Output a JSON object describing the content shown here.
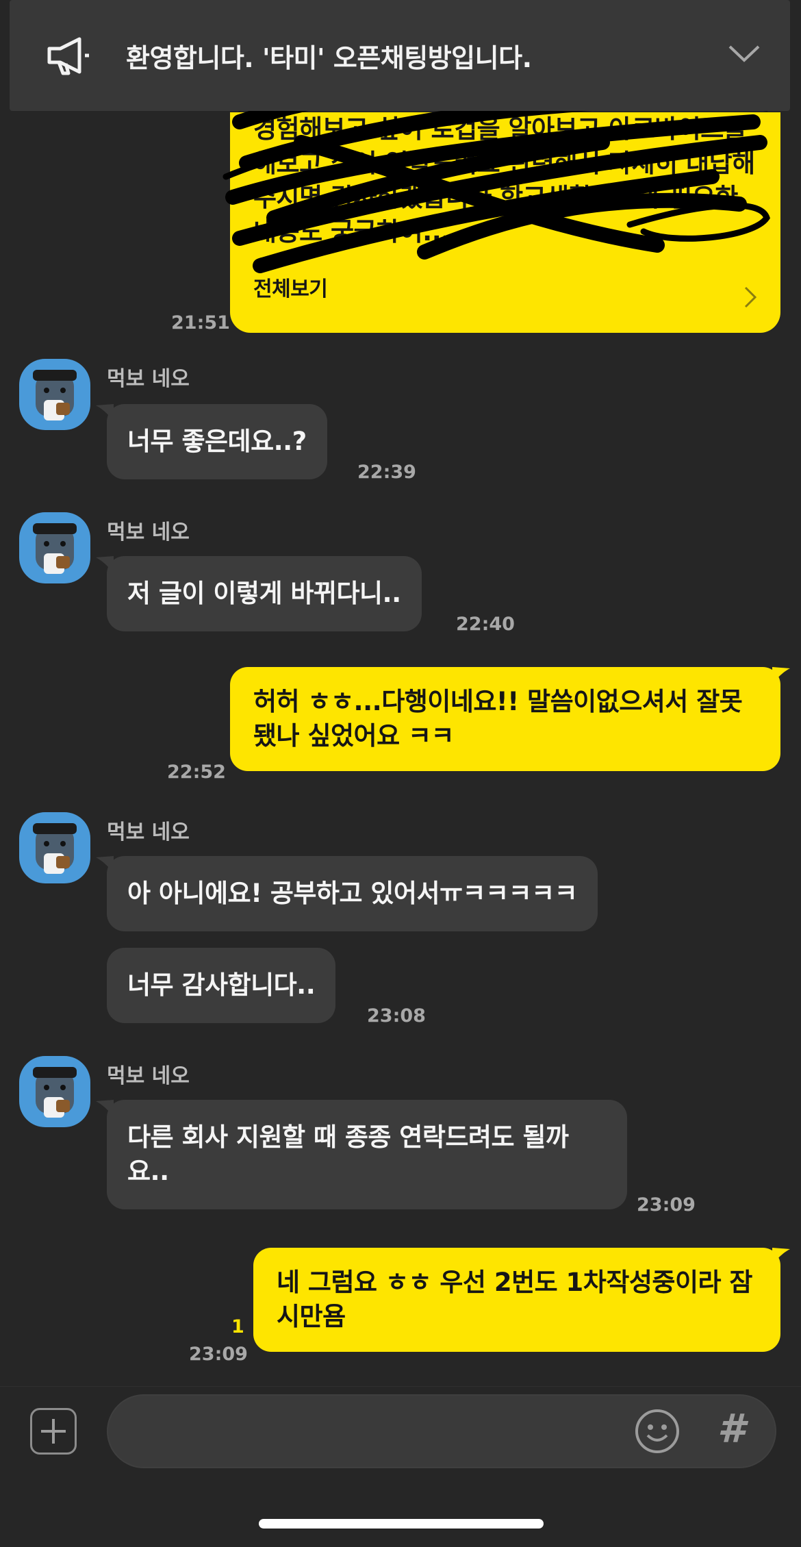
{
  "notice": {
    "icon": "megaphone-icon",
    "text": "환영합니다. '타미' 오픈채팅방입니다.",
    "collapse_icon": "chevron-down-icon"
  },
  "messages": {
    "m0": {
      "preview": "경험해보고 싶어 로컵을 알아보고 아르바이트를 해보고 싶어 연락드려요 관련해서 자세히 대답해주시면 감사하겠습니다 학교생활방식과 필요한 내용도 궁금하여...",
      "more_label": "전체보기",
      "time": "21:51"
    },
    "sender_name": "먹보 네오",
    "m1": {
      "text": "너무 좋은데요..?",
      "time": "22:39"
    },
    "m2": {
      "text": "저 글이 이렇게 바뀌다니..",
      "time": "22:40"
    },
    "m3": {
      "text": "허허 ㅎㅎ...다행이네요!! 말씀이없으셔서 잘못됐나 싶었어요 ㅋㅋ",
      "time": "22:52"
    },
    "m4": {
      "text": "아 아니에요! 공부하고 있어서ㅠㅋㅋㅋㅋㅋ"
    },
    "m5": {
      "text": "너무 감사합니다..",
      "time": "23:08"
    },
    "m6": {
      "text": "다른 회사 지원할 때 종종 연락드려도 될까요..",
      "time": "23:09"
    },
    "m7": {
      "text": "네 그럼요 ㅎㅎ 우선 2번도 1차작성중이라 잠시만욤",
      "time": "23:09",
      "unread": "1"
    }
  },
  "composer": {
    "placeholder": "",
    "plus_icon": "plus-icon",
    "emoji_icon": "emoji-icon",
    "hash_label": "#"
  },
  "colors": {
    "background": "#262626",
    "incoming_bubble": "#3c3c3c",
    "outgoing_bubble": "#fee500",
    "avatar": "#4a9ad9",
    "unread": "#fee500"
  }
}
